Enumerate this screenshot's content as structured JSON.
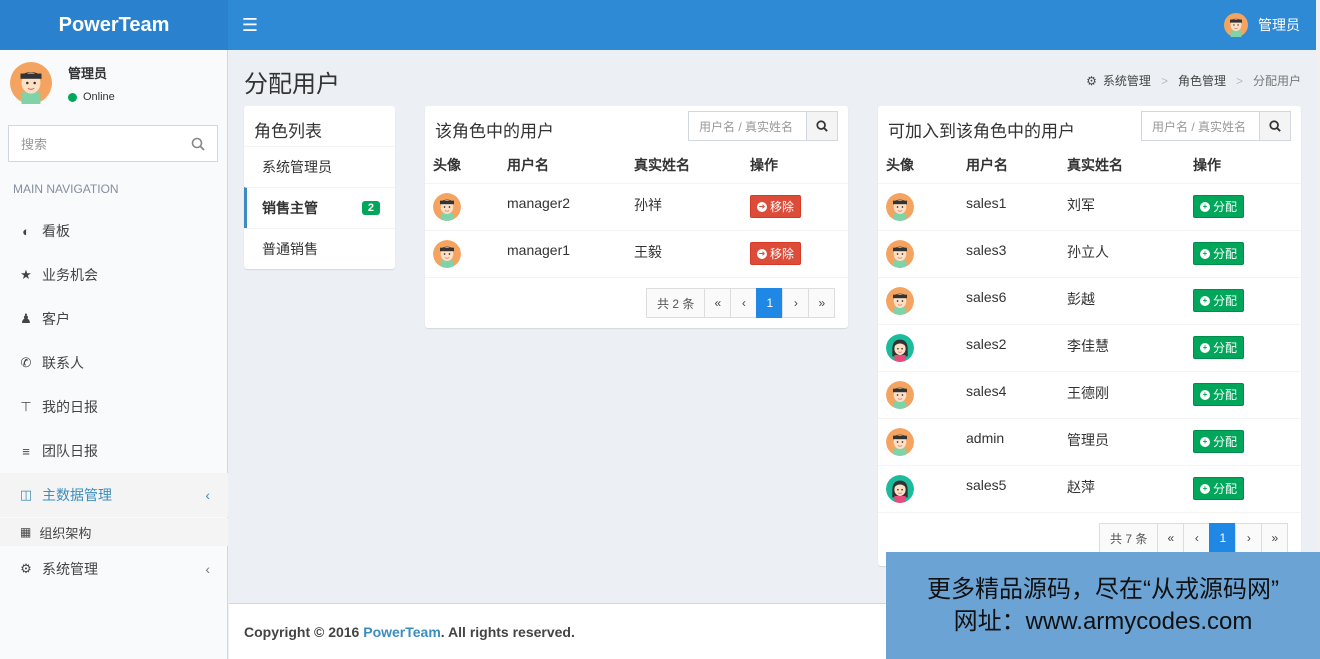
{
  "header": {
    "brand": "PowerTeam",
    "menu_icon": "hamburger-icon",
    "user_name": "管理员"
  },
  "sidebar": {
    "user": {
      "name": "管理员",
      "status": "Online"
    },
    "search_placeholder": "搜索",
    "nav_header": "MAIN NAVIGATION",
    "items": [
      {
        "label": "看板",
        "icon": "dashboard-icon"
      },
      {
        "label": "业务机会",
        "icon": "star-icon"
      },
      {
        "label": "客户",
        "icon": "users-icon"
      },
      {
        "label": "联系人",
        "icon": "phone-icon"
      },
      {
        "label": "我的日报",
        "icon": "pin-icon"
      },
      {
        "label": "团队日报",
        "icon": "list-icon"
      },
      {
        "label": "主数据管理",
        "icon": "database-icon"
      },
      {
        "label": "组织架构",
        "icon": "sitemap-icon"
      },
      {
        "label": "系统管理",
        "icon": "cogs-icon"
      }
    ]
  },
  "page": {
    "title": "分配用户",
    "breadcrumb": [
      "系统管理",
      "角色管理",
      "分配用户"
    ]
  },
  "roles": {
    "title": "角色列表",
    "items": [
      {
        "label": "系统管理员"
      },
      {
        "label": "销售主管",
        "badge": "2"
      },
      {
        "label": "普通销售"
      }
    ]
  },
  "members": {
    "title": "该角色中的用户",
    "search_placeholder": "用户名 / 真实姓名",
    "columns": [
      "头像",
      "用户名",
      "真实姓名",
      "操作"
    ],
    "action_label": "移除",
    "rows": [
      {
        "username": "manager2",
        "realname": "孙祥",
        "avatar": "male"
      },
      {
        "username": "manager1",
        "realname": "王毅",
        "avatar": "male"
      }
    ],
    "pager": {
      "total": "共 2 条",
      "first": "«",
      "prev": "‹",
      "current": "1",
      "next": "›",
      "last": "»"
    }
  },
  "candidates": {
    "title": "可加入到该角色中的用户",
    "search_placeholder": "用户名 / 真实姓名",
    "columns": [
      "头像",
      "用户名",
      "真实姓名",
      "操作"
    ],
    "action_label": "分配",
    "rows": [
      {
        "username": "sales1",
        "realname": "刘军",
        "avatar": "male"
      },
      {
        "username": "sales3",
        "realname": "孙立人",
        "avatar": "male"
      },
      {
        "username": "sales6",
        "realname": "彭越",
        "avatar": "male"
      },
      {
        "username": "sales2",
        "realname": "李佳慧",
        "avatar": "female"
      },
      {
        "username": "sales4",
        "realname": "王德刚",
        "avatar": "male"
      },
      {
        "username": "admin",
        "realname": "管理员",
        "avatar": "male"
      },
      {
        "username": "sales5",
        "realname": "赵萍",
        "avatar": "female"
      }
    ],
    "pager": {
      "total": "共 7 条",
      "first": "«",
      "prev": "‹",
      "current": "1",
      "next": "›",
      "last": "»"
    }
  },
  "footer": {
    "prefix": "Copyright © 2016",
    "brand": "PowerTeam",
    "suffix": ". All rights reserved."
  },
  "watermark": {
    "line1": "更多精品源码，尽在“从戎源码网”",
    "line2": "网址：www.armycodes.com"
  },
  "colors": {
    "header": "#2f8ad6",
    "accent": "#3c8dbc",
    "danger": "#dd4b39",
    "success": "#00a65a"
  }
}
